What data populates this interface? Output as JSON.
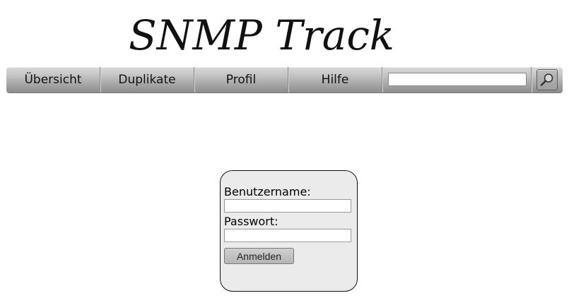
{
  "logo": {
    "text": "SNMP Track"
  },
  "nav": {
    "items": [
      {
        "label": "Übersicht"
      },
      {
        "label": "Duplikate"
      },
      {
        "label": "Profil"
      },
      {
        "label": "Hilfe"
      }
    ],
    "search": {
      "value": "",
      "placeholder": "",
      "icon": "magnifier-icon"
    }
  },
  "login": {
    "username_label": "Benutzername:",
    "username_value": "",
    "password_label": "Passwort:",
    "password_value": "",
    "submit_label": "Anmelden"
  },
  "colors": {
    "nav_gradient_top": "#d9d9d9",
    "nav_gradient_bottom": "#8c8c8c",
    "login_box_background": "#ebebeb",
    "text": "#111111"
  }
}
